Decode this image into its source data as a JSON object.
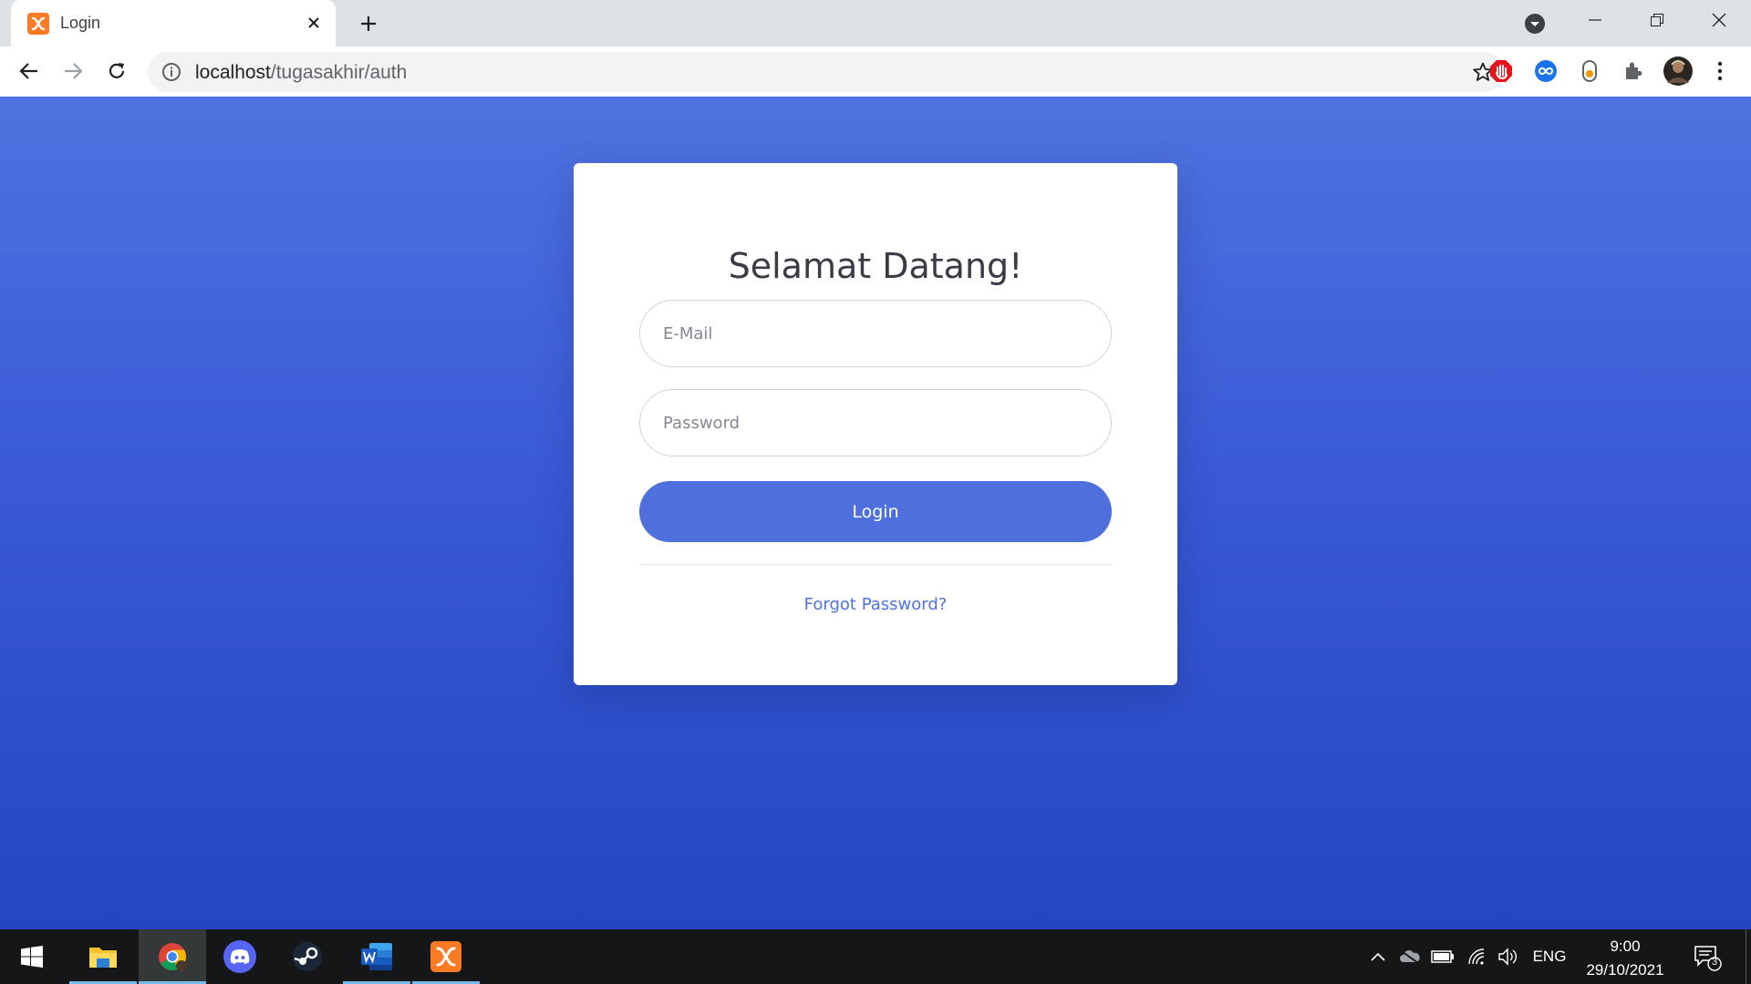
{
  "browser": {
    "tab": {
      "title": "Login",
      "favicon": "xampp-icon"
    },
    "address": {
      "host": "localhost",
      "path": "/tugasakhir/auth"
    },
    "colors": {
      "accent": "#4e73df"
    }
  },
  "page": {
    "heading": "Selamat Datang!",
    "email": {
      "placeholder": "E-Mail",
      "value": ""
    },
    "password": {
      "placeholder": "Password",
      "value": ""
    },
    "login_label": "Login",
    "forgot_label": "Forgot Password?"
  },
  "taskbar": {
    "apps": [
      "file-explorer-icon",
      "chrome-icon",
      "discord-icon",
      "steam-icon",
      "word-icon",
      "xampp-icon"
    ],
    "language": "ENG",
    "time": "9:00",
    "date": "29/10/2021",
    "notification_count": "3"
  }
}
